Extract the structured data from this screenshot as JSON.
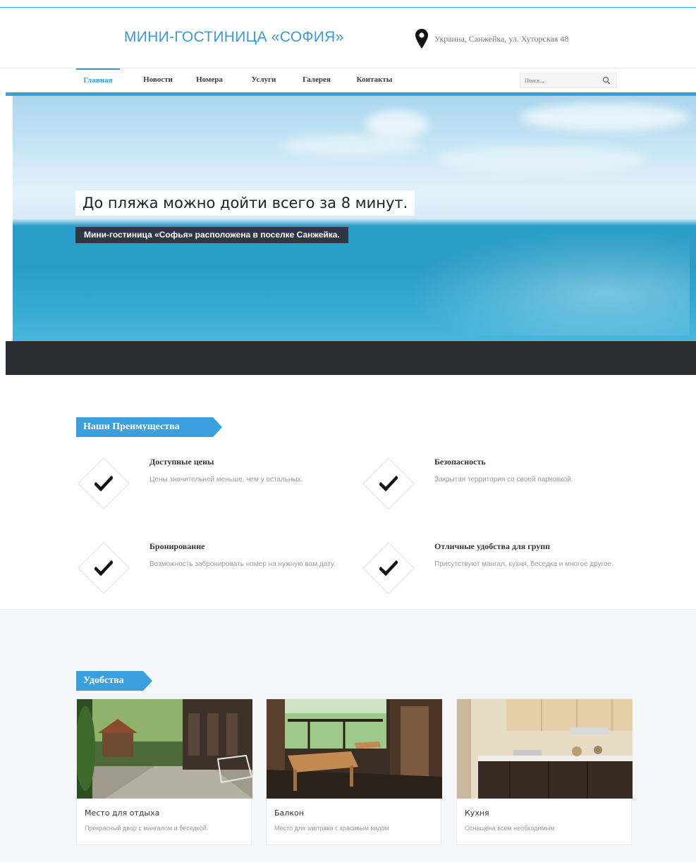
{
  "header": {
    "site_title": "МИНИ-ГОСТИНИЦА «СОФИЯ»",
    "address": "Украина, Санжейка, ул. Хуторская 48"
  },
  "nav": {
    "items": [
      {
        "label": "Главная",
        "active": true
      },
      {
        "label": "Новости",
        "active": false
      },
      {
        "label": "Номера",
        "active": false
      },
      {
        "label": "Услуги",
        "active": false
      },
      {
        "label": "Галерея",
        "active": false
      },
      {
        "label": "Контакты",
        "active": false
      }
    ],
    "search_placeholder": "Поиск..."
  },
  "hero": {
    "heading": "До пляжа можно дойти всего за 8 минут.",
    "subheading": "Мини-гостиница «Софья» расположена в поселке Санжейка."
  },
  "advantages": {
    "section_title": "Наши Преимущества",
    "items": [
      {
        "title": "Доступные цены",
        "description": "Цены значительней меньше, чем у остальных."
      },
      {
        "title": "Безопасность",
        "description": "Закрытая территория со своей парковкой."
      },
      {
        "title": "Бронирование",
        "description": "Возможность забронировать номер на нужную вам дату."
      },
      {
        "title": "Отличные удобства для групп",
        "description": "Присутствуют мангал, кухня, беседка и многое другое."
      }
    ]
  },
  "amenities": {
    "section_title": "Удобства",
    "cards": [
      {
        "title": "Место для отдыха",
        "description": "Прекрасный двор с мангалом и беседкой."
      },
      {
        "title": "Балкон",
        "description": "Место для завтрака с красивым видом"
      },
      {
        "title": "Кухня",
        "description": "Оснащена всем необходимым"
      }
    ]
  },
  "colors": {
    "accent": "#3aa0dd",
    "dark_band": "#2b2d33"
  },
  "icons": {
    "address": "map-pin-icon",
    "search": "search-icon",
    "feature": "checkmark-icon"
  }
}
